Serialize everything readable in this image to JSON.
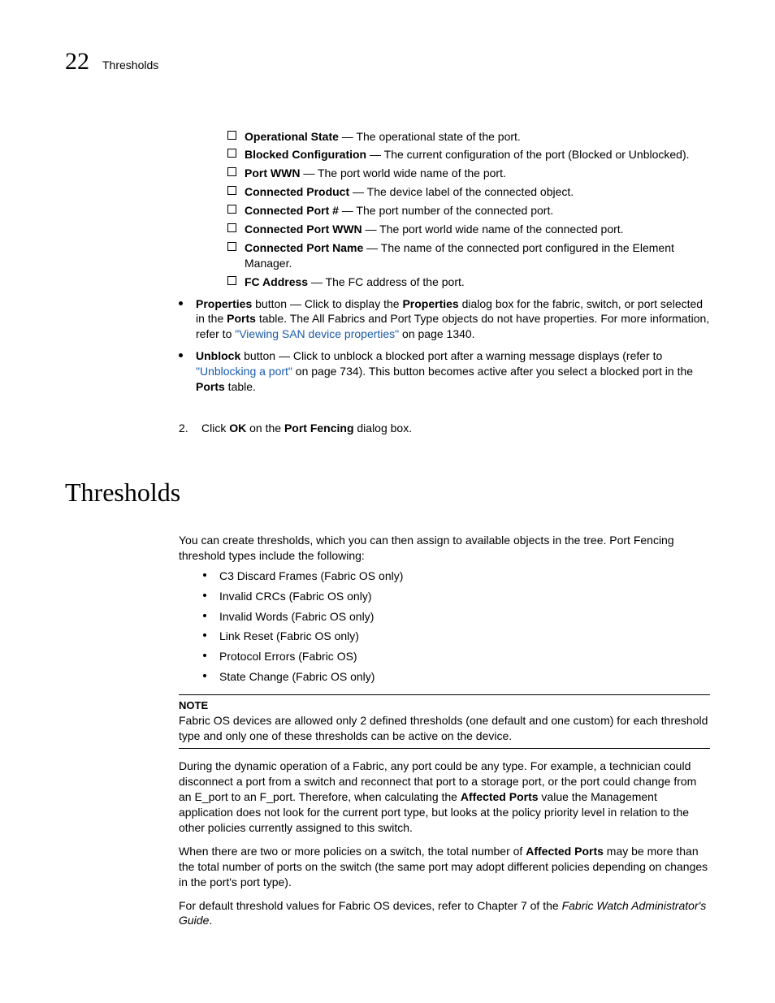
{
  "header": {
    "chapter_number": "22",
    "chapter_title": "Thresholds"
  },
  "checkbox_items": [
    {
      "term": "Operational State",
      "desc": " — The operational state of the port."
    },
    {
      "term": "Blocked Configuration",
      "desc": " — The current configuration of the port (Blocked or Unblocked)."
    },
    {
      "term": "Port WWN",
      "desc": " — The port world wide name of the port."
    },
    {
      "term": "Connected Product",
      "desc": " — The device label of the connected object."
    },
    {
      "term": "Connected Port #",
      "desc": " — The port number of the connected port."
    },
    {
      "term": "Connected Port WWN",
      "desc": " — The port world wide name of the connected port."
    },
    {
      "term": "Connected Port Name",
      "desc": " — The name of the connected port configured in the Element Manager."
    },
    {
      "term": "FC Address",
      "desc": " — The FC address of the port."
    }
  ],
  "bullet_properties": {
    "lead_bold": "Properties",
    "after_lead": " button — Click to display the ",
    "mid_bold": "Properties",
    "after_mid": " dialog box for the fabric, switch, or port selected in the ",
    "ports_bold": "Ports",
    "after_ports": " table. The All Fabrics and Port Type objects do not have properties. For more information, refer to ",
    "link_text": "\"Viewing SAN device properties\"",
    "after_link": " on page 1340."
  },
  "bullet_unblock": {
    "lead_bold": "Unblock",
    "after_lead": " button — Click to unblock a blocked port after a warning message displays (refer to ",
    "link_text": "\"Unblocking a port\"",
    "after_link": " on page 734). This button becomes active after you select a blocked port in the ",
    "ports_bold": "Ports",
    "tail": " table."
  },
  "step2": {
    "num": "2.",
    "pre": "Click ",
    "ok": "OK",
    "mid": " on the ",
    "pf": "Port Fencing",
    "suf": " dialog box."
  },
  "section_heading": "Thresholds",
  "intro_para": "You can create thresholds, which you can then assign to available objects in the tree. Port Fencing threshold types include the following:",
  "threshold_types": [
    "C3 Discard Frames (Fabric OS only)",
    "Invalid CRCs (Fabric OS only)",
    "Invalid Words (Fabric OS only)",
    "Link Reset (Fabric OS only)",
    "Protocol Errors (Fabric OS)",
    "State Change (Fabric OS only)"
  ],
  "note": {
    "label": "NOTE",
    "text": "Fabric OS devices are allowed only 2 defined thresholds (one default and one custom) for each threshold type and only one of these thresholds can be active on the device."
  },
  "para_dynamic": {
    "p1": "During the dynamic operation of a Fabric, any port could be any type. For example, a technician could disconnect a port from a switch and reconnect that port to a storage port, or the port could change from an E_port to an F_port. Therefore, when calculating the ",
    "bold": "Affected Ports",
    "p2": " value the Management application does not look for the current port type, but looks at the policy priority level in relation to the other policies currently assigned to this switch."
  },
  "para_two_policies": {
    "p1": "When there are two or more policies on a switch, the total number of ",
    "bold": "Affected Ports",
    "p2": " may be more than the total number of ports on the switch (the same port may adopt different policies depending on changes in the port's port type)."
  },
  "para_default": {
    "p1": "For default threshold values for Fabric OS devices, refer to Chapter 7 of the ",
    "ital": "Fabric Watch Administrator's Guide",
    "p2": "."
  }
}
